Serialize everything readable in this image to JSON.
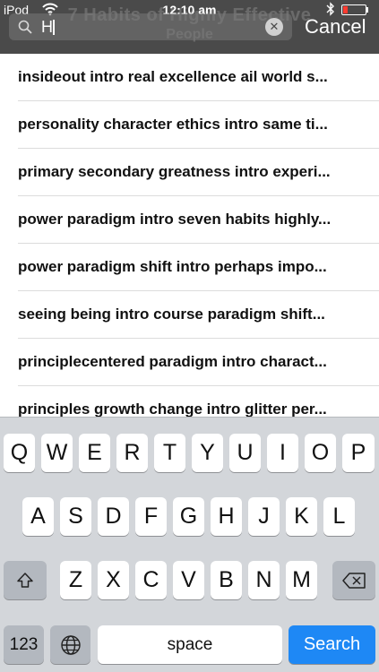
{
  "status_bar": {
    "carrier": "iPod",
    "time": "12:10 am"
  },
  "header": {
    "background_title": "7 Habits of Highly Effective",
    "background_subtitle": "People",
    "search": {
      "value": "H",
      "placeholder": ""
    },
    "cancel_label": "Cancel"
  },
  "results": [
    "insideout intro real excellence ail world s...",
    "personality character ethics intro same ti...",
    "primary secondary greatness intro experi...",
    "power paradigm intro seven habits highly...",
    "power paradigm shift intro perhaps impo...",
    "seeing being intro course paradigm shift...",
    "principlecentered paradigm intro charact...",
    "principles growth change intro glitter per..."
  ],
  "keyboard": {
    "row1": [
      "Q",
      "W",
      "E",
      "R",
      "T",
      "Y",
      "U",
      "I",
      "O",
      "P"
    ],
    "row2": [
      "A",
      "S",
      "D",
      "F",
      "G",
      "H",
      "J",
      "K",
      "L"
    ],
    "row3": [
      "Z",
      "X",
      "C",
      "V",
      "B",
      "N",
      "M"
    ],
    "numbers_label": "123",
    "space_label": "space",
    "search_label": "Search"
  },
  "icons": {
    "shift": "shift-icon",
    "delete": "delete-icon",
    "globe": "globe-icon",
    "search": "search-icon",
    "clear": "clear-icon"
  },
  "colors": {
    "header_bg": "#4a4a4a",
    "keyboard_bg": "#d3d6da",
    "search_key": "#1e88f5",
    "battery_low": "#ff3b30"
  }
}
